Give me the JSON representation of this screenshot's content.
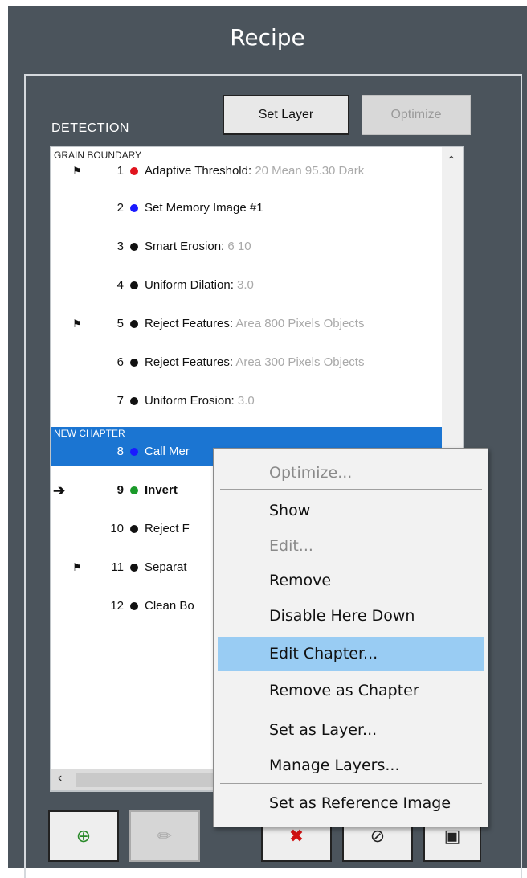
{
  "window": {
    "title": "Recipe"
  },
  "detection": {
    "label": "DETECTION",
    "set_layer_button": "Set Layer",
    "optimize_button": "Optimize"
  },
  "list": {
    "chapters": [
      "GRAIN BOUNDARY",
      "NEW CHAPTER"
    ],
    "items": [
      {
        "num": "1",
        "dot": "#e0141e",
        "name": "Adaptive Threshold:",
        "params": "20 Mean 95.30 Dark",
        "flag": true
      },
      {
        "num": "2",
        "dot": "#1a1aff",
        "name": "Set Memory Image #1",
        "params": ""
      },
      {
        "num": "3",
        "dot": "#111111",
        "name": "Smart Erosion:",
        "params": "6 10"
      },
      {
        "num": "4",
        "dot": "#111111",
        "name": "Uniform Dilation:",
        "params": "3.0"
      },
      {
        "num": "5",
        "dot": "#111111",
        "name": "Reject Features:",
        "params": "Area 800 Pixels Objects",
        "flag": true
      },
      {
        "num": "6",
        "dot": "#111111",
        "name": "Reject Features:",
        "params": "Area 300 Pixels Objects"
      },
      {
        "num": "7",
        "dot": "#111111",
        "name": "Uniform Erosion:",
        "params": "3.0"
      },
      {
        "num": "8",
        "dot": "#1a1aff",
        "name": "Call Mer",
        "params": "",
        "selected": true
      },
      {
        "num": "9",
        "dot": "#1a9a2a",
        "name": "Invert",
        "params": "",
        "current": true
      },
      {
        "num": "10",
        "dot": "#111111",
        "name": "Reject F",
        "params": ""
      },
      {
        "num": "11",
        "dot": "#111111",
        "name": "Separat",
        "params": "",
        "flag": true
      },
      {
        "num": "12",
        "dot": "#111111",
        "name": "Clean Bo",
        "params": ""
      }
    ]
  },
  "toolbar": {
    "add_icon": "crosshair-add-icon",
    "edit_icon": "pencil-icon",
    "delete_icon": "x-icon",
    "disable_icon": "no-symbol-icon",
    "trash_icon": "trash-icon"
  },
  "context_menu": {
    "items": [
      {
        "label": "Optimize...",
        "disabled": true
      },
      {
        "label": "Show"
      },
      {
        "label": "Edit...",
        "disabled": true
      },
      {
        "label": "Remove"
      },
      {
        "label": "Disable Here Down"
      },
      {
        "label": "Edit Chapter...",
        "highlighted": true
      },
      {
        "label": "Remove as Chapter"
      },
      {
        "label": "Set as Layer..."
      },
      {
        "label": "Manage Layers..."
      },
      {
        "label": "Set as Reference Image"
      }
    ]
  },
  "colors": {
    "panel": "#4b545c",
    "selection": "#1b75d2",
    "menu_highlight": "#99ccf3"
  }
}
